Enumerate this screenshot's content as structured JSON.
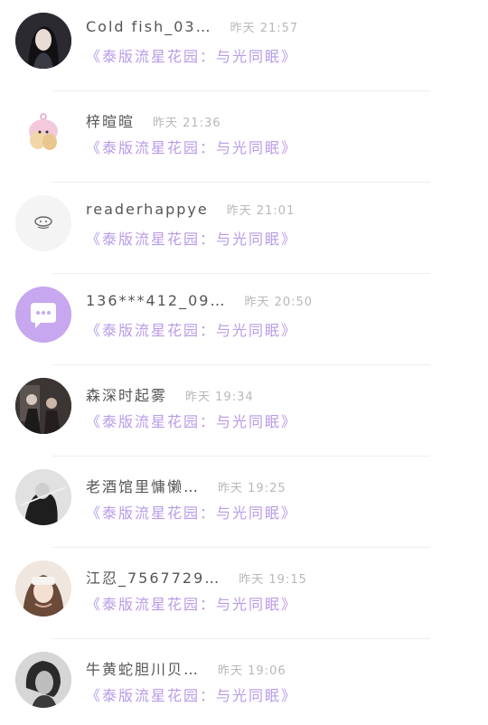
{
  "comments": [
    {
      "username": "Cold fish_03…",
      "time": "昨天 21:57",
      "book_link": "《泰版流星花园：与光同眠》",
      "avatar": "photo-avatar"
    },
    {
      "username": "梓暄暄",
      "time": "昨天 21:36",
      "book_link": "《泰版流星花园：与光同眠》",
      "avatar": "cartoon-avatar"
    },
    {
      "username": "readerhappye",
      "time": "昨天 21:01",
      "book_link": "《泰版流星花园：与光同眠》",
      "avatar": "default-avatar"
    },
    {
      "username": "136***412_09…",
      "time": "昨天 20:50",
      "book_link": "《泰版流星花园：与光同眠》",
      "avatar": "chat-bubble-avatar"
    },
    {
      "username": "森深时起雾",
      "time": "昨天 19:34",
      "book_link": "《泰版流星花园：与光同眠》",
      "avatar": "photo-avatar"
    },
    {
      "username": "老酒馆里慵懒…",
      "time": "昨天 19:25",
      "book_link": "《泰版流星花园：与光同眠》",
      "avatar": "photo-avatar"
    },
    {
      "username": "江忍_7567729…",
      "time": "昨天 19:15",
      "book_link": "《泰版流星花园：与光同眠》",
      "avatar": "photo-avatar"
    },
    {
      "username": "牛黄蛇胆川贝…",
      "time": "昨天 19:06",
      "book_link": "《泰版流星花园：与光同眠》",
      "avatar": "photo-avatar"
    }
  ],
  "colors": {
    "username": "#555555",
    "time": "#b8b8b8",
    "book_link": "#b79be8",
    "chat_avatar_bg": "#c7a7ef",
    "divider": "#eeeeee"
  }
}
